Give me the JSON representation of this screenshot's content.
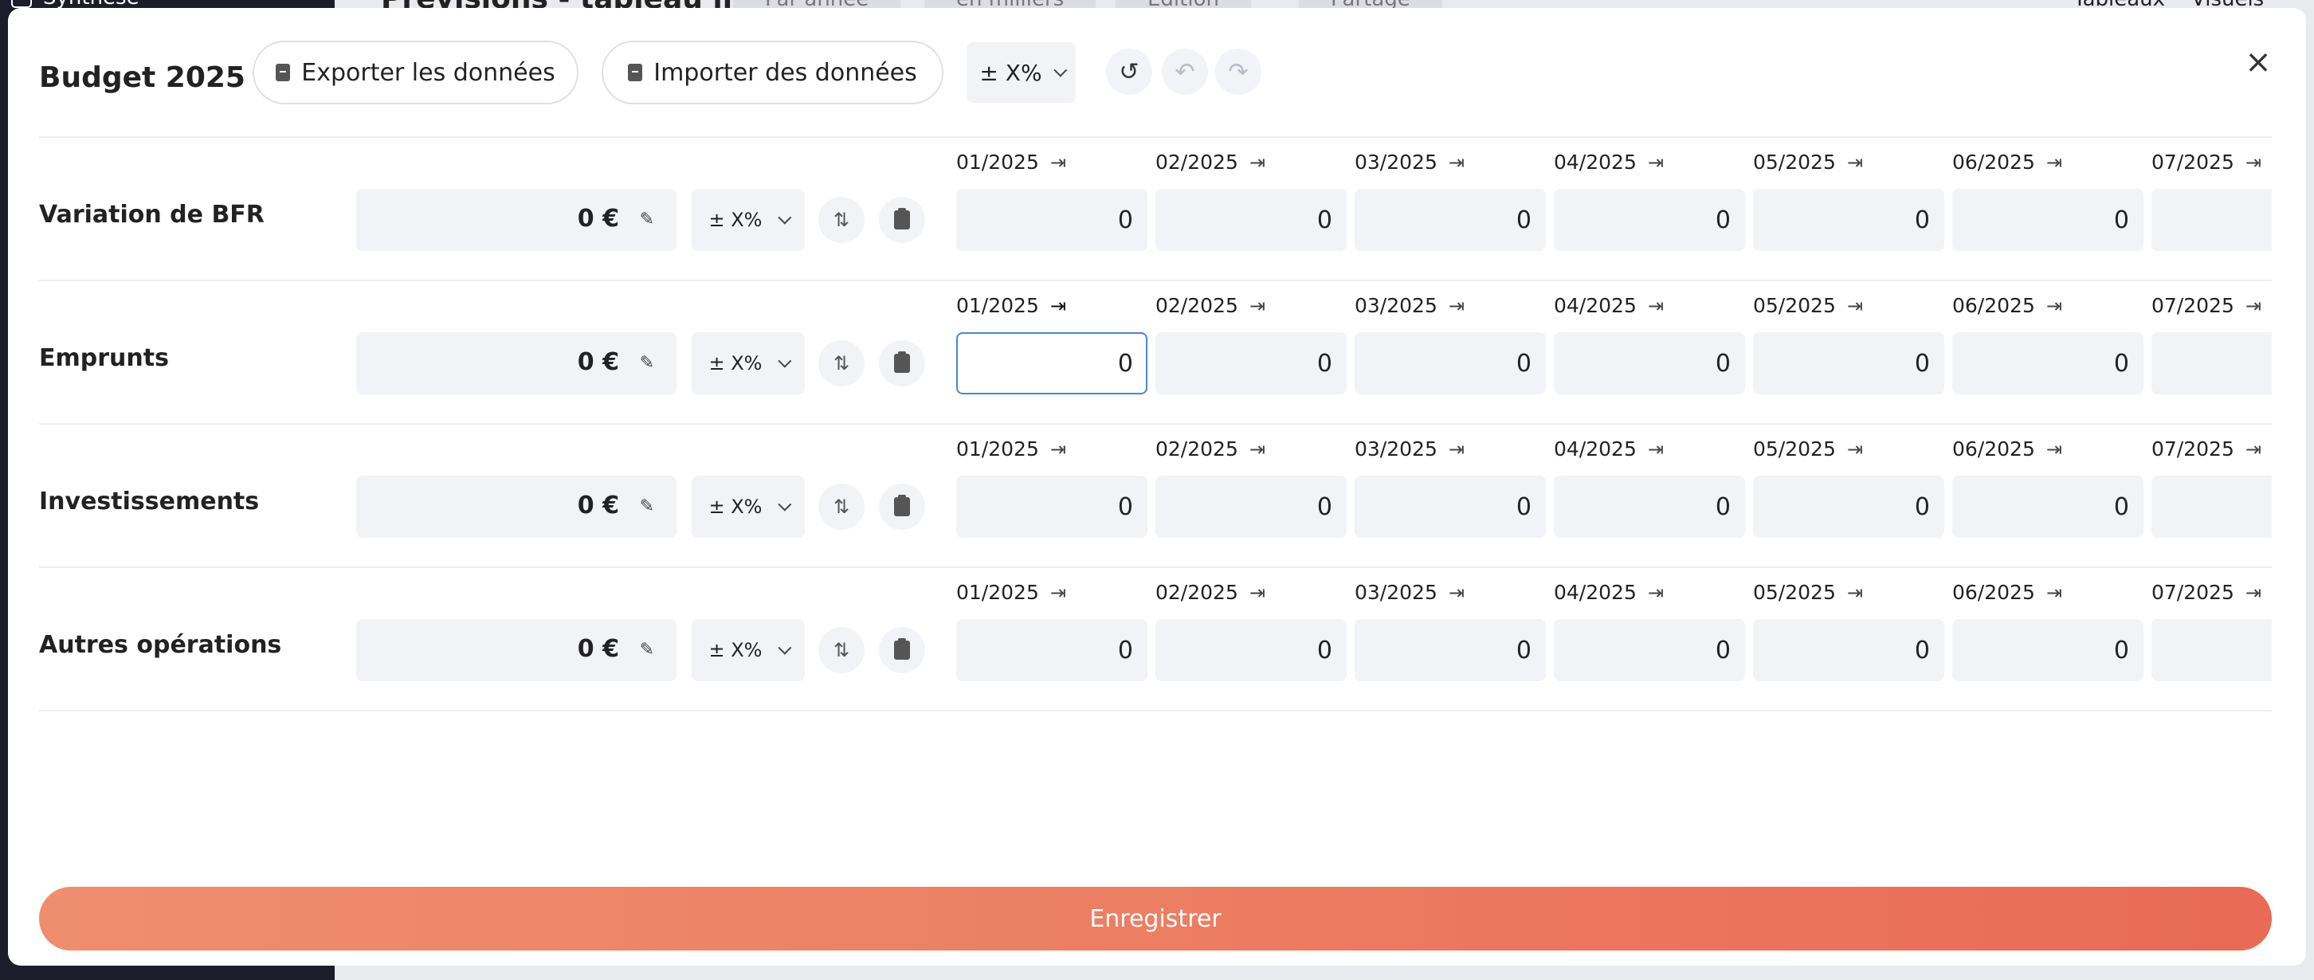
{
  "background": {
    "sidebar_item": "Synthèse",
    "title": "Prévisions - tableau libre",
    "tabs": [
      "Par année",
      "en milliers",
      "Édition",
      "Partage"
    ],
    "right_tabs": [
      "Tableaux",
      "Visuels"
    ]
  },
  "modal": {
    "title": "Budget 2025",
    "export_label": "Exporter les données",
    "import_label": "Importer des données",
    "pct_label": "± X%",
    "history_icon": "history-icon",
    "undo_icon": "undo-icon",
    "redo_icon": "redo-icon",
    "close_icon": "close-icon",
    "save_label": "Enregistrer"
  },
  "rows": [
    {
      "label": "Variation de BFR",
      "total": "0 €",
      "pct": "± X%",
      "months": [
        {
          "label": "01/2025",
          "value": "0"
        },
        {
          "label": "02/2025",
          "value": "0"
        },
        {
          "label": "03/2025",
          "value": "0"
        },
        {
          "label": "04/2025",
          "value": "0"
        },
        {
          "label": "05/2025",
          "value": "0"
        },
        {
          "label": "06/2025",
          "value": "0"
        },
        {
          "label": "07/2025",
          "value": "0"
        }
      ]
    },
    {
      "label": "Emprunts",
      "total": "0 €",
      "pct": "± X%",
      "focused_month": "01/2025",
      "months": [
        {
          "label": "01/2025",
          "value": "0"
        },
        {
          "label": "02/2025",
          "value": "0"
        },
        {
          "label": "03/2025",
          "value": "0"
        },
        {
          "label": "04/2025",
          "value": "0"
        },
        {
          "label": "05/2025",
          "value": "0"
        },
        {
          "label": "06/2025",
          "value": "0"
        },
        {
          "label": "07/2025",
          "value": "0"
        }
      ]
    },
    {
      "label": "Investissements",
      "total": "0 €",
      "pct": "± X%",
      "months": [
        {
          "label": "01/2025",
          "value": "0"
        },
        {
          "label": "02/2025",
          "value": "0"
        },
        {
          "label": "03/2025",
          "value": "0"
        },
        {
          "label": "04/2025",
          "value": "0"
        },
        {
          "label": "05/2025",
          "value": "0"
        },
        {
          "label": "06/2025",
          "value": "0"
        },
        {
          "label": "07/2025",
          "value": "0"
        }
      ]
    },
    {
      "label": "Autres opérations",
      "total": "0 €",
      "pct": "± X%",
      "months": [
        {
          "label": "01/2025",
          "value": "0"
        },
        {
          "label": "02/2025",
          "value": "0"
        },
        {
          "label": "03/2025",
          "value": "0"
        },
        {
          "label": "04/2025",
          "value": "0"
        },
        {
          "label": "05/2025",
          "value": "0"
        },
        {
          "label": "06/2025",
          "value": "0"
        },
        {
          "label": "07/2025",
          "value": "0"
        }
      ]
    }
  ],
  "colors": {
    "accent_start": "#ef8e6f",
    "accent_end": "#e96a55",
    "focus_border": "#4a86d9"
  }
}
